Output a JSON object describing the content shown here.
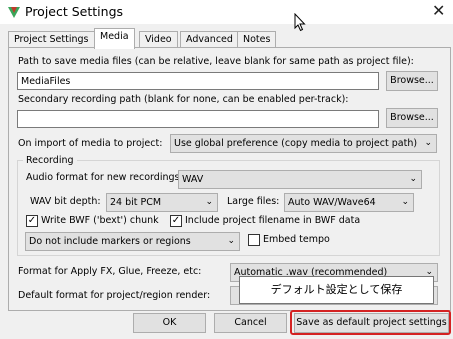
{
  "window": {
    "title": "Project Settings",
    "close_glyph": "✕"
  },
  "tabs": [
    {
      "label": "Project Settings",
      "active": false
    },
    {
      "label": "Media",
      "active": true
    },
    {
      "label": "Video",
      "active": false
    },
    {
      "label": "Advanced",
      "active": false
    },
    {
      "label": "Notes",
      "active": false
    }
  ],
  "media": {
    "path_label": "Path to save media files (can be relative, leave blank for same path as project file):",
    "path_value": "MediaFiles",
    "browse_label": "Browse...",
    "secondary_label": "Secondary recording path (blank for none, can be enabled per-track):",
    "secondary_value": "",
    "browse2_label": "Browse...",
    "import_label": "On import of media to project:",
    "import_value": "Use global preference (copy media to project path)"
  },
  "recording": {
    "group_label": "Recording",
    "format_label": "Audio format for new recordings:",
    "format_value": "WAV",
    "bitdepth_label": "WAV bit depth:",
    "bitdepth_value": "24 bit PCM",
    "largefiles_label": "Large files:",
    "largefiles_value": "Auto WAV/Wave64",
    "bwf_label": "Write BWF ('bext') chunk",
    "bwf_checked": true,
    "include_name_label": "Include project filename in BWF data",
    "include_name_checked": true,
    "markers_value": "Do not include markers or regions",
    "embed_tempo_label": "Embed tempo",
    "embed_tempo_checked": false
  },
  "format_apply": {
    "label": "Format for Apply FX, Glue, Freeze, etc:",
    "value": "Automatic .wav (recommended)"
  },
  "default_render": {
    "label": "Default format for project/region render:"
  },
  "tooltip": "デフォルト設定として保存",
  "buttons": {
    "ok": "OK",
    "cancel": "Cancel",
    "save_default": "Save as default project settings"
  },
  "colors": {
    "highlight": "#d42222",
    "app_icon_green": "#3aa55a",
    "app_icon_red": "#c0392b"
  },
  "icons": {
    "app": "reaper-app-icon",
    "close": "close-icon",
    "cursor": "mouse-cursor-icon",
    "chevron": "chevron-down-icon"
  }
}
